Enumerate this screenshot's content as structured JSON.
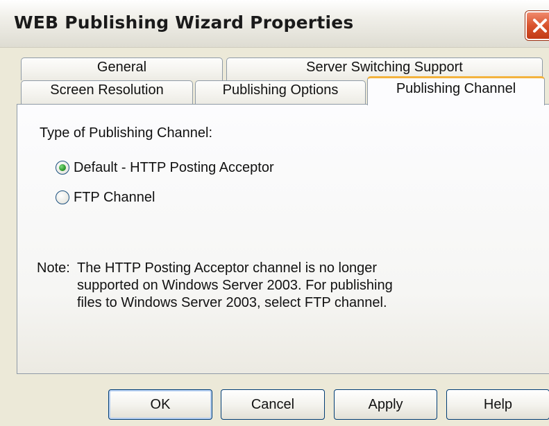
{
  "window": {
    "title": "WEB Publishing Wizard Properties"
  },
  "tabs": {
    "row1": [
      "General",
      "Server Switching Support"
    ],
    "row2": [
      "Screen Resolution",
      "Publishing Options",
      "Publishing Channel"
    ],
    "active": "Publishing Channel"
  },
  "panel": {
    "type_label": "Type of Publishing Channel:",
    "options": [
      {
        "label": "Default - HTTP Posting Acceptor",
        "selected": true
      },
      {
        "label": "FTP Channel",
        "selected": false
      }
    ],
    "note_label": "Note:",
    "note_lines": [
      "The HTTP Posting Acceptor channel is no longer",
      "supported on Windows Server 2003.  For publishing",
      "files to Windows Server 2003, select FTP channel."
    ]
  },
  "buttons": {
    "ok": "OK",
    "cancel": "Cancel",
    "apply": "Apply",
    "help": "Help"
  },
  "icons": {
    "close": "close-icon"
  },
  "colors": {
    "window_bg": "#ece9d8",
    "close_red": "#d9532d",
    "active_tab_accent": "#f3b33d",
    "radio_selected": "#2f9a2f"
  }
}
